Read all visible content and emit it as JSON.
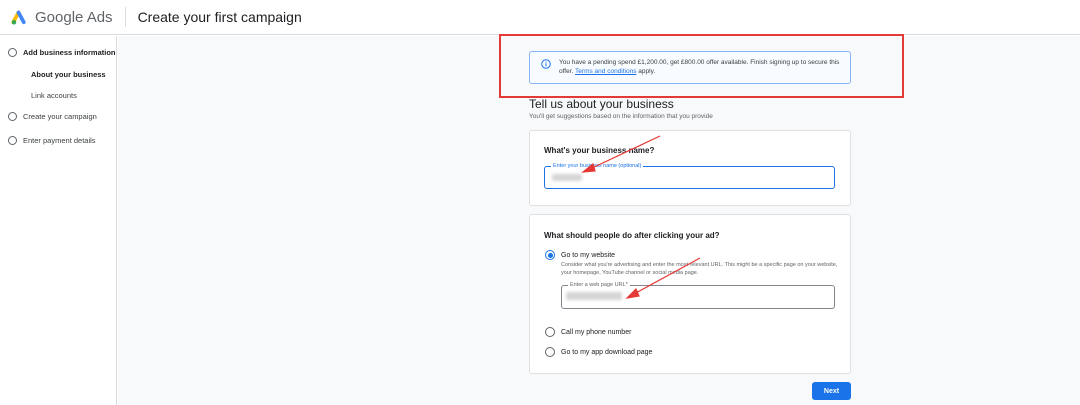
{
  "header": {
    "brand": "Google Ads",
    "title": "Create your first campaign"
  },
  "sidebar": {
    "steps": [
      {
        "label": "Add business information",
        "substeps": [
          "About your business",
          "Link accounts"
        ]
      },
      {
        "label": "Create your campaign"
      },
      {
        "label": "Enter payment details"
      }
    ]
  },
  "promo": {
    "text": "You have a pending spend £1,200.00, get £800.00 offer available. Finish signing up to secure this offer.",
    "link": "Terms and conditions",
    "suffix": "apply."
  },
  "main": {
    "title": "Tell us about your business",
    "subtitle": "You'll get suggestions based on the information that you provide"
  },
  "business_card": {
    "title": "What's your business name?",
    "field_label": "Enter your business name (optional)"
  },
  "action_card": {
    "title": "What should people do after clicking your ad?",
    "options": [
      {
        "label": "Go to my website",
        "checked": true
      },
      {
        "label": "Call my phone number",
        "checked": false
      },
      {
        "label": "Go to my app download page",
        "checked": false
      }
    ],
    "website_desc": "Consider what you're advertising and enter the most relevant URL. This might be a specific page on your website, your homepage, YouTube channel or social media page.",
    "url_label": "Enter a web page URL*"
  },
  "next_label": "Next",
  "colors": {
    "accent": "#1a73e8",
    "annotation": "#e53935"
  }
}
